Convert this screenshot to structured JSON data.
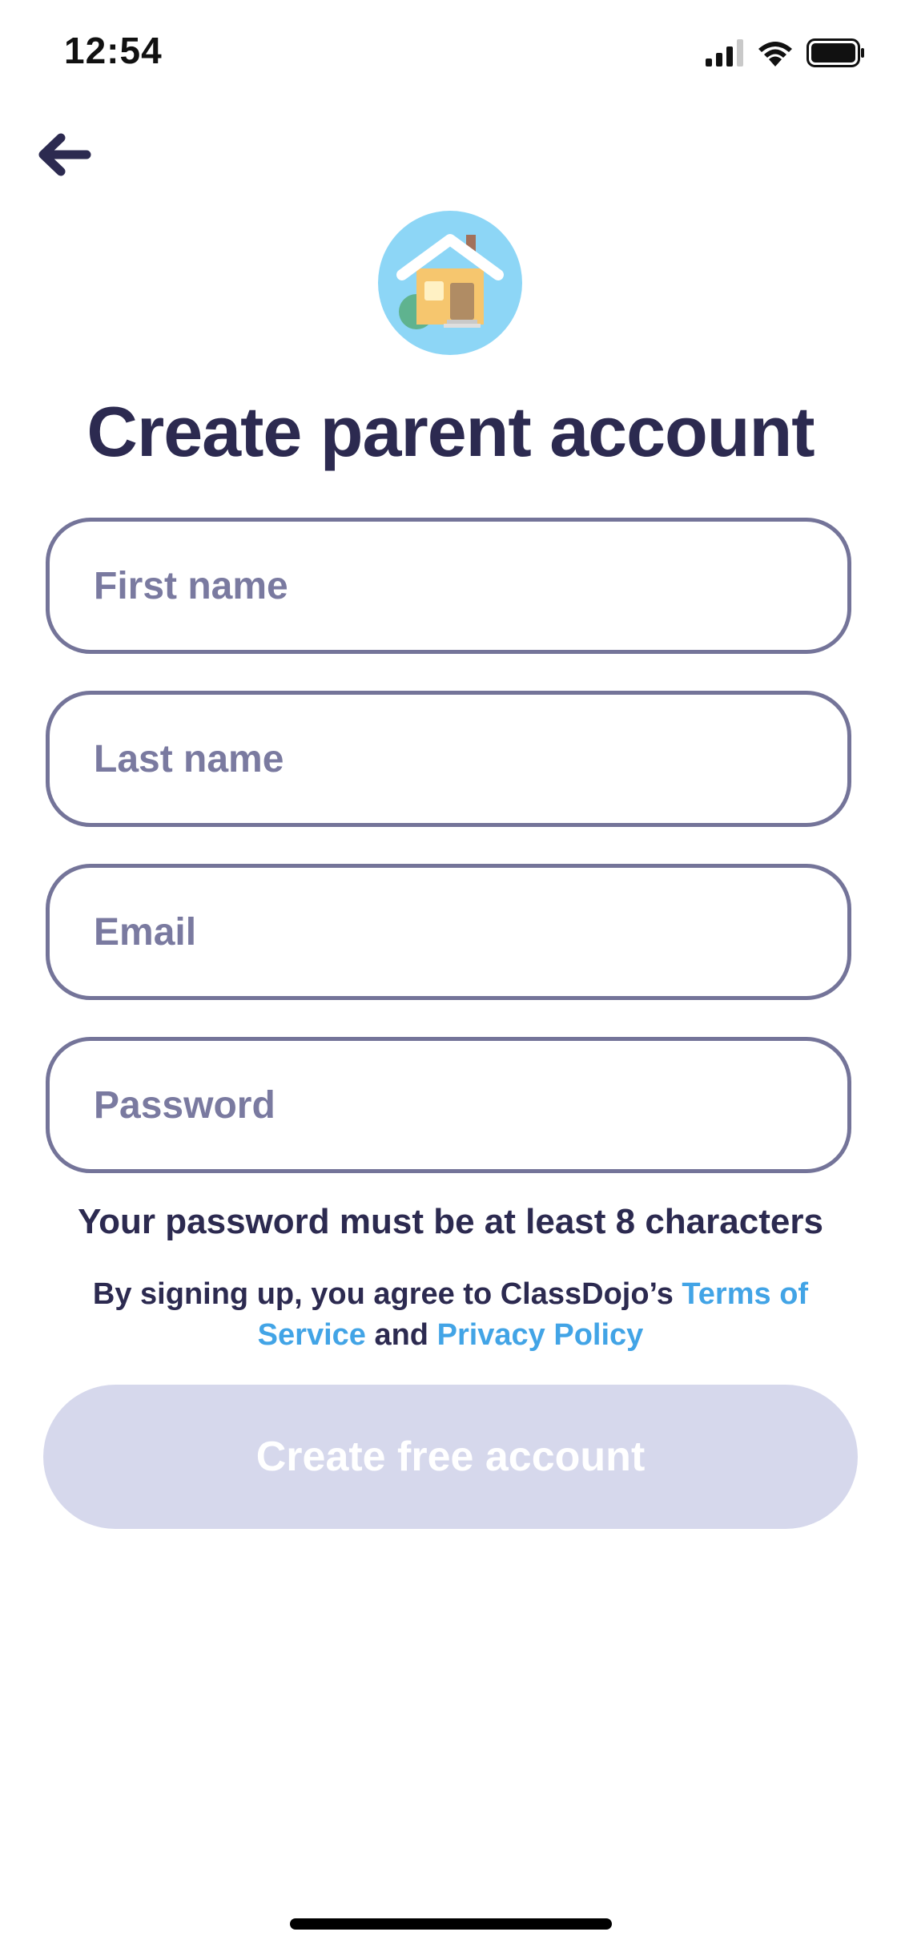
{
  "status_bar": {
    "time": "12:54",
    "signal_icon": "cellular-signal-icon",
    "wifi_icon": "wifi-icon",
    "battery_icon": "battery-icon"
  },
  "header": {
    "back_icon": "arrow-left-icon",
    "avatar_icon": "house-icon",
    "title": "Create parent account"
  },
  "form": {
    "first_name": {
      "placeholder": "First name",
      "value": ""
    },
    "last_name": {
      "placeholder": "Last name",
      "value": ""
    },
    "email": {
      "placeholder": "Email",
      "value": ""
    },
    "password": {
      "placeholder": "Password",
      "value": ""
    }
  },
  "password_hint": "Your password must be at least 8 characters",
  "legal": {
    "prefix": "By signing up, you agree to ClassDojo’s ",
    "terms_link": "Terms of Service",
    "conjunction": " and ",
    "privacy_link": "Privacy Policy"
  },
  "submit_button": {
    "label": "Create free account",
    "enabled": false
  },
  "colors": {
    "text_primary": "#2c2a50",
    "field_border": "#747499",
    "placeholder": "#7a7aa0",
    "link": "#42a4e6",
    "button_disabled_bg": "#d6d8ec",
    "avatar_bg": "#8dd6f6"
  }
}
